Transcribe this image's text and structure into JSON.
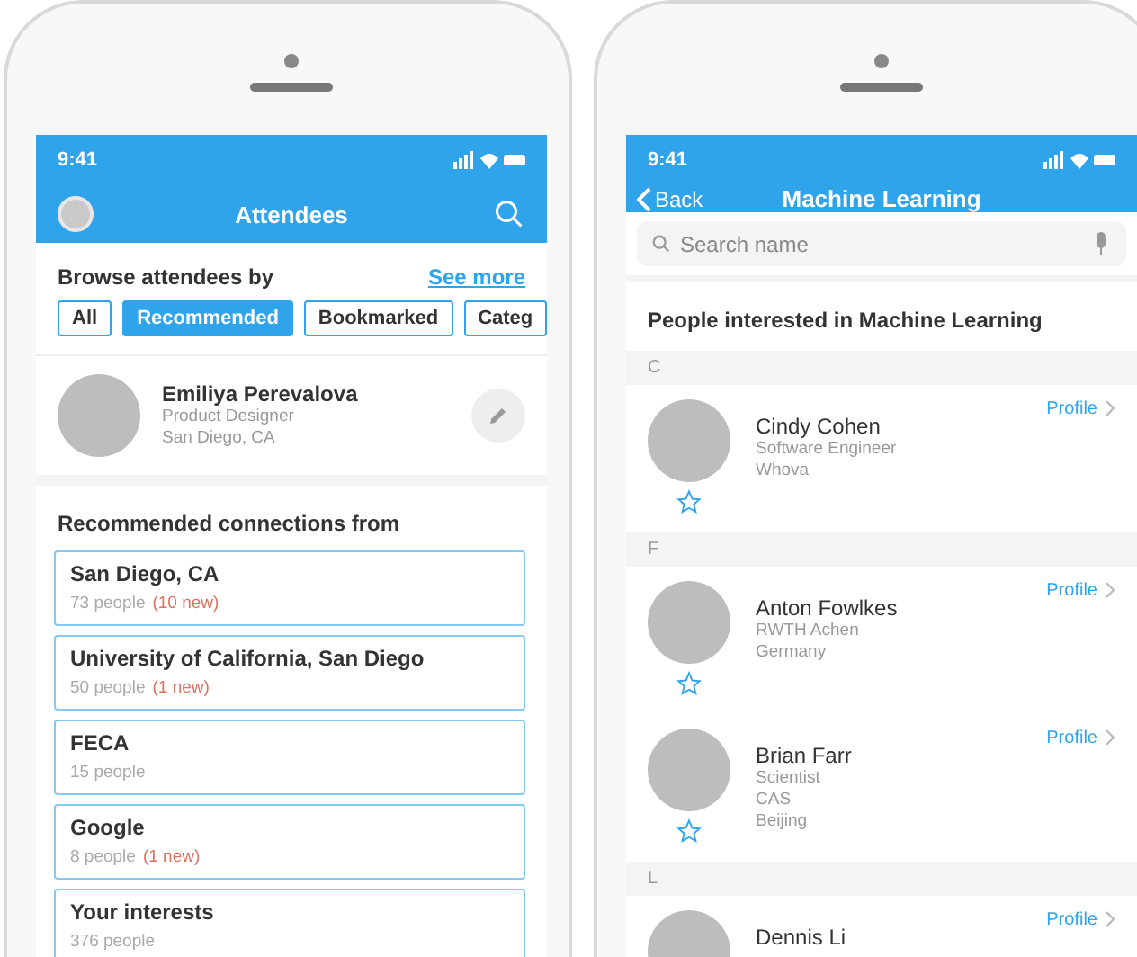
{
  "left_screen": {
    "status_time": "9:41",
    "title": "Attendees",
    "browse_label": "Browse attendees by",
    "see_more": "See more",
    "filters": [
      {
        "label": "All",
        "selected": false
      },
      {
        "label": "Recommended",
        "selected": true
      },
      {
        "label": "Bookmarked",
        "selected": false
      },
      {
        "label": "Categ",
        "selected": false
      }
    ],
    "profile": {
      "name": "Emiliya Perevalova",
      "title": "Product Designer",
      "location": "San Diego, CA"
    },
    "section_title": "Recommended connections from",
    "connections": [
      {
        "name": "San Diego, CA",
        "count": "73 people",
        "new": "(10 new)"
      },
      {
        "name": "University of California, San Diego",
        "count": "50 people",
        "new": "(1 new)"
      },
      {
        "name": "FECA",
        "count": "15 people"
      },
      {
        "name": "Google",
        "count": "8 people",
        "new": "(1 new)"
      },
      {
        "name": "Your interests",
        "count": "376 people"
      }
    ]
  },
  "right_screen": {
    "status_time": "9:41",
    "back": "Back",
    "title": "Machine Learning",
    "search": {
      "placeholder": "Search name"
    },
    "heading": "People interested in Machine Learning",
    "groups": [
      {
        "letter": "C",
        "people": [
          {
            "name": "Cindy Cohen",
            "details": [
              "Software Engineer",
              "Whova"
            ],
            "link": "Profile",
            "bookmarked": false
          }
        ]
      },
      {
        "letter": "F",
        "people": [
          {
            "name": "Anton Fowlkes",
            "details": [
              "RWTH Achen",
              "Germany"
            ],
            "link": "Profile",
            "bookmarked": false
          },
          {
            "name": "Brian Farr",
            "details": [
              "Scientist",
              "CAS",
              "Beijing"
            ],
            "link": "Profile",
            "bookmarked": false
          }
        ]
      },
      {
        "letter": "L",
        "people": [
          {
            "name": "Dennis Li",
            "link": "Profile"
          }
        ]
      }
    ]
  }
}
